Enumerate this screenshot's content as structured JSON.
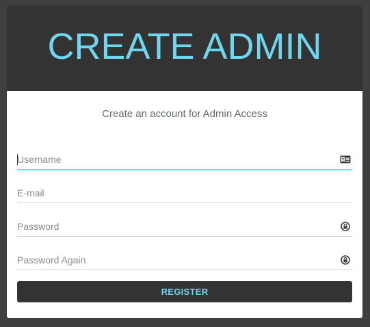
{
  "banner": {
    "title": "CREATE ADMIN"
  },
  "subtitle": "Create an account for Admin Access",
  "form": {
    "username": {
      "placeholder": "Username",
      "value": "",
      "icon": "id-card-icon"
    },
    "email": {
      "placeholder": "E-mail",
      "value": ""
    },
    "password": {
      "placeholder": "Password",
      "value": "",
      "icon": "lock-icon"
    },
    "password_again": {
      "placeholder": "Password Again",
      "value": "",
      "icon": "lock-icon"
    }
  },
  "register_label": "REGISTER",
  "colors": {
    "accent": "#6fd6f0",
    "banner": "#333333",
    "page_background": "#3f3f3f",
    "card": "#ffffff"
  }
}
